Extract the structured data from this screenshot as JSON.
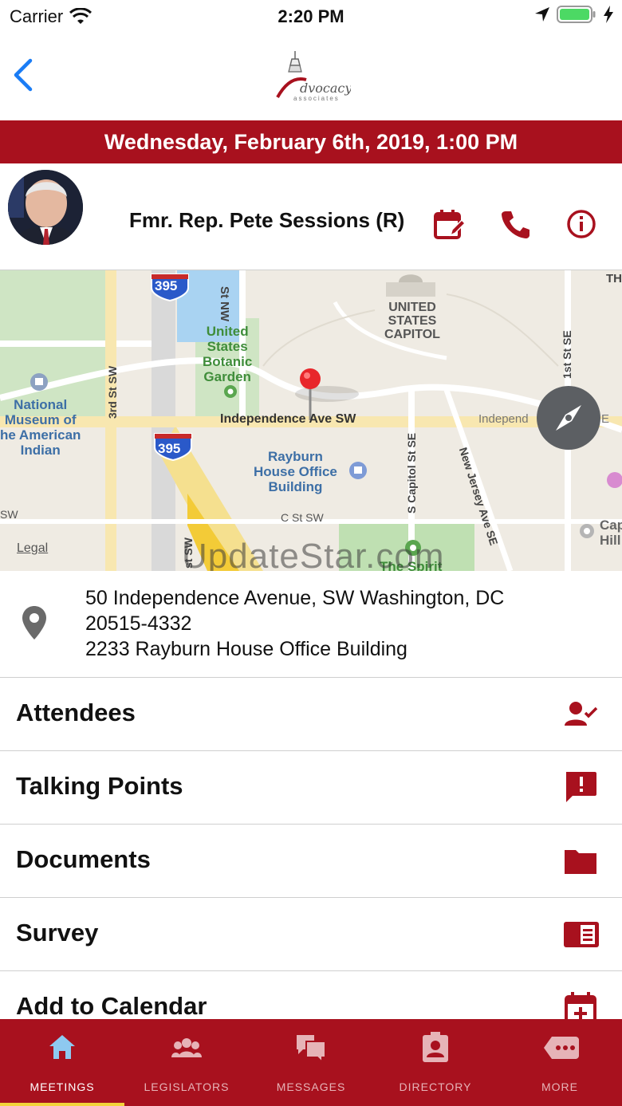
{
  "status_bar": {
    "carrier": "Carrier",
    "time": "2:20 PM",
    "battery_color": "#4cd964"
  },
  "header": {
    "back_icon": "chevron-left-icon",
    "logo_text": "Advocacy",
    "logo_subtext": "associates"
  },
  "meeting": {
    "datetime": "Wednesday, February 6th, 2019, 1:00 PM",
    "legislator_name": "Fmr. Rep. Pete Sessions (R)",
    "actions": [
      "calendar-edit-icon",
      "phone-icon",
      "info-icon"
    ]
  },
  "map": {
    "labels": {
      "st_nw": "St NW",
      "capitol": [
        "UNITED",
        "STATES",
        "CAPITOL"
      ],
      "th": "TH",
      "first_st_se": "1st St SE",
      "botanic": [
        "United",
        "States",
        "Botanic",
        "Garden"
      ],
      "third_st_sw": "3rd St SW",
      "museum": [
        "National",
        "Museum of",
        "he American",
        "Indian"
      ],
      "independence": "Independence Ave SW",
      "independ_right": "Independ",
      "e": "E",
      "rayburn": [
        "Rayburn",
        "House Office",
        "Building"
      ],
      "s_capitol": "S Capitol St SE",
      "new_jersey": "New Jersey Ave SE",
      "sw": "SW",
      "c_st_sw": "C St SW",
      "st_sw": "st SW",
      "cap_hill": [
        "Cap",
        "Hill"
      ],
      "the_spirit": "The Spirit",
      "i395_top": "395",
      "i395_mid": "395"
    },
    "legal": "Legal",
    "watermark": "UpdateStar.com"
  },
  "address": {
    "line1": "50 Independence Avenue, SW Washington, DC",
    "line2": "20515-4332",
    "line3": "2233 Rayburn House Office Building"
  },
  "rows": [
    {
      "label": "Attendees",
      "icon": "person-check-icon"
    },
    {
      "label": "Talking Points",
      "icon": "feedback-icon"
    },
    {
      "label": "Documents",
      "icon": "folder-icon"
    },
    {
      "label": "Survey",
      "icon": "survey-icon"
    },
    {
      "label": "Add to Calendar",
      "icon": "calendar-add-icon"
    }
  ],
  "tabs": [
    {
      "label": "MEETINGS",
      "icon": "home-icon",
      "active": true
    },
    {
      "label": "LEGISLATORS",
      "icon": "people-icon",
      "active": false
    },
    {
      "label": "MESSAGES",
      "icon": "chat-icon",
      "active": false
    },
    {
      "label": "DIRECTORY",
      "icon": "contact-card-icon",
      "active": false
    },
    {
      "label": "MORE",
      "icon": "more-icon",
      "active": false
    }
  ],
  "colors": {
    "brand_red": "#a8111e",
    "ios_blue": "#1a7cf5",
    "active_indicator": "#f2d33a"
  }
}
